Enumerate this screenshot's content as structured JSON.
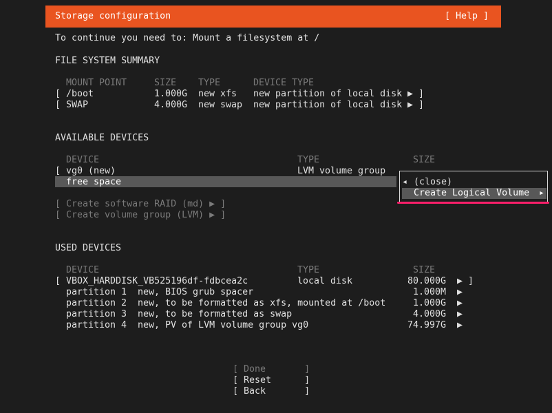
{
  "header": {
    "title": "Storage configuration",
    "help": "[ Help ]"
  },
  "instruction": "To continue you need to: Mount a filesystem at /",
  "fs_summary": {
    "heading": "FILE SYSTEM SUMMARY",
    "columns": [
      "MOUNT POINT",
      "SIZE",
      "TYPE",
      "DEVICE TYPE"
    ],
    "rows": [
      {
        "open": "[",
        "mount": "/boot",
        "size": "1.000G",
        "type": "new xfs",
        "device_type": "new partition of local disk",
        "arrow": "▶ ]"
      },
      {
        "open": "[",
        "mount": "SWAP",
        "size": "4.000G",
        "type": "new swap",
        "device_type": "new partition of local disk",
        "arrow": "▶ ]"
      }
    ]
  },
  "available": {
    "heading": "AVAILABLE DEVICES",
    "columns": [
      "DEVICE",
      "TYPE",
      "SIZE"
    ],
    "vg_open": "[",
    "vg_name": "vg0 (new)",
    "vg_type": "LVM volume group",
    "free_space": "free space",
    "create_raid": "[ Create software RAID (md) ▶ ]",
    "create_vg": "[ Create volume group (LVM) ▶ ]"
  },
  "popup": {
    "close_arrow": "◂",
    "close": "(close)",
    "create_lv": "Create Logical Volume",
    "create_lv_arrow": "▸"
  },
  "used": {
    "heading": "USED DEVICES",
    "columns": [
      "DEVICE",
      "TYPE",
      "SIZE"
    ],
    "disk_open": "[",
    "disk_name": "VBOX_HARDDISK_VB525196df-fdbcea2c",
    "disk_type": "local disk",
    "disk_size": "80.000G",
    "disk_arrow": "▶ ]",
    "partitions": [
      {
        "name": "partition 1",
        "desc": "new, BIOS grub spacer",
        "size": "1.000M",
        "arrow": "▶"
      },
      {
        "name": "partition 2",
        "desc": "new, to be formatted as xfs, mounted at /boot",
        "size": "1.000G",
        "arrow": "▶"
      },
      {
        "name": "partition 3",
        "desc": "new, to be formatted as swap",
        "size": "4.000G",
        "arrow": "▶"
      },
      {
        "name": "partition 4",
        "desc": "new, PV of LVM volume group vg0",
        "size": "74.997G",
        "arrow": "▶"
      }
    ]
  },
  "footer": {
    "done": "[ Done       ]",
    "reset": "[ Reset      ]",
    "back": "[ Back       ]"
  },
  "colors": {
    "header": "#e95420",
    "highlight": "#585858",
    "annotation": "#ff1f6b"
  }
}
